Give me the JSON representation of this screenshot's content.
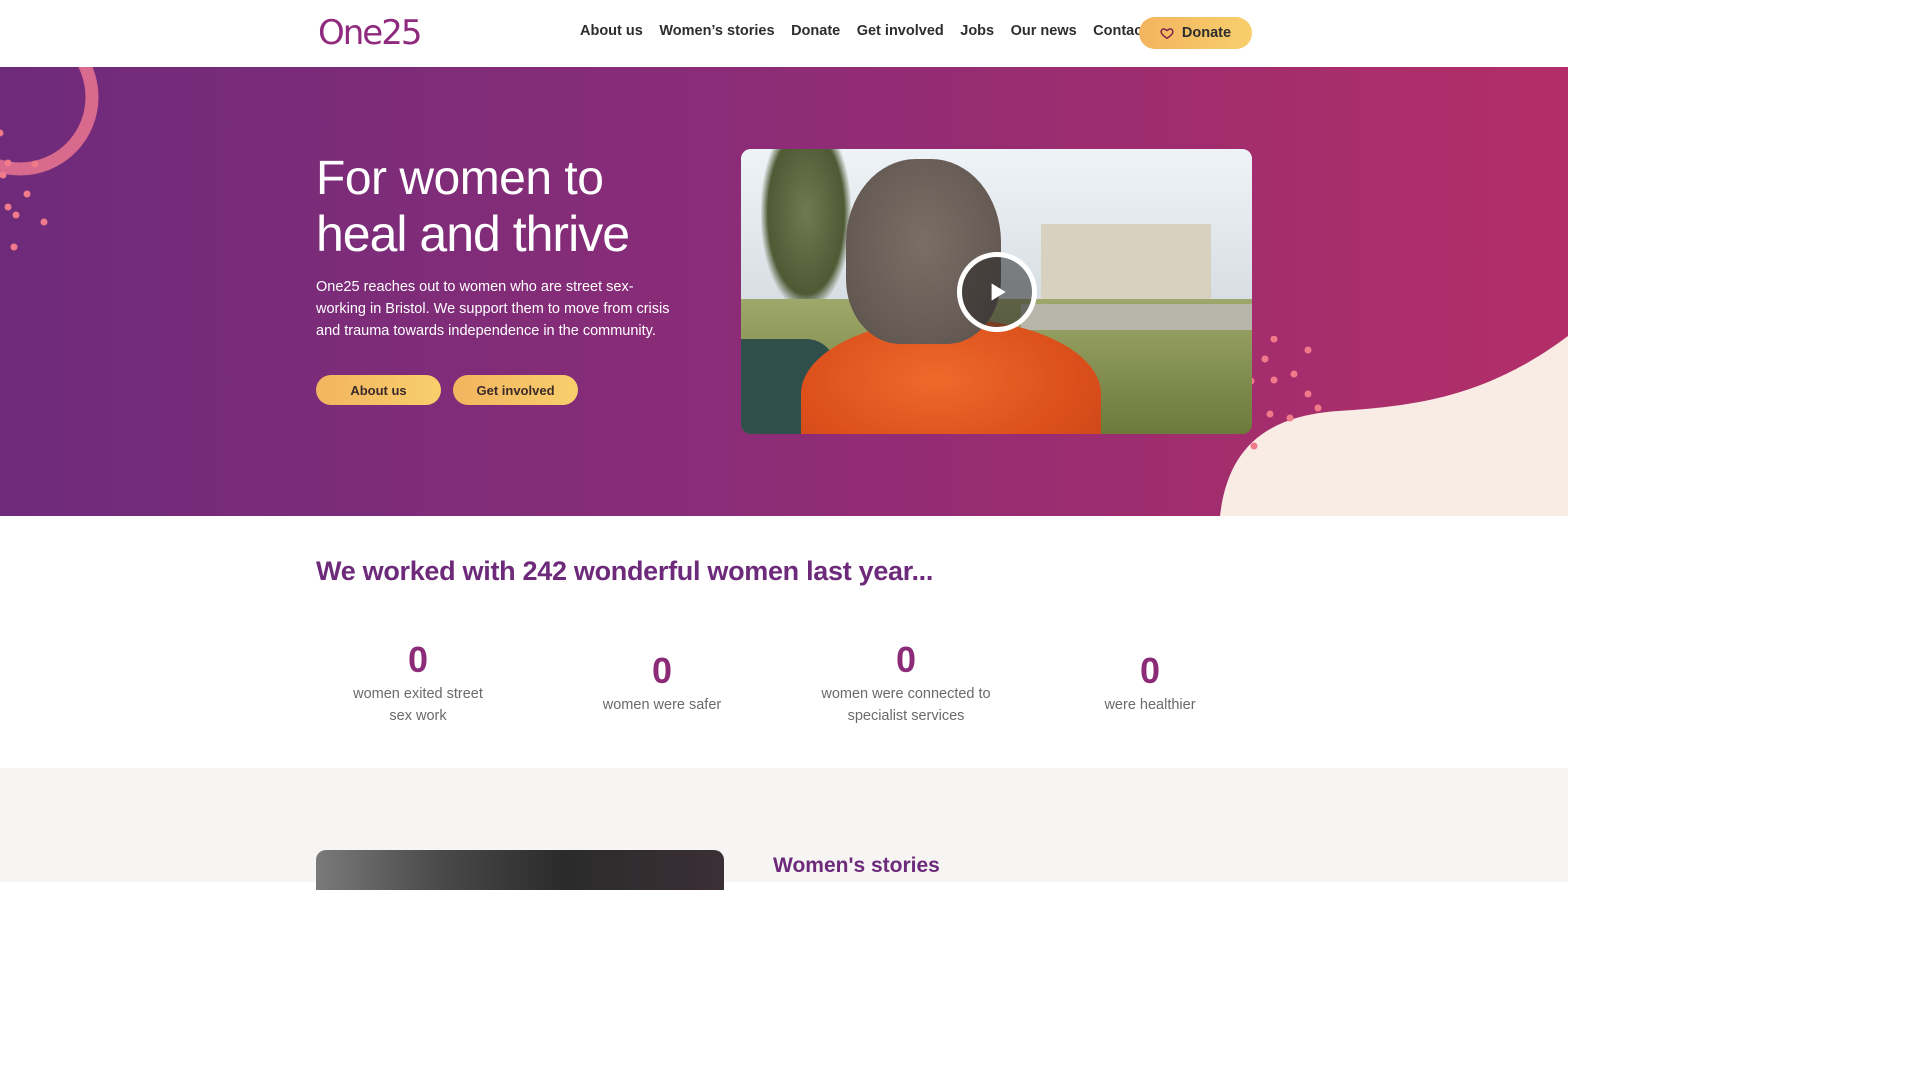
{
  "header": {
    "logo_text": "One25",
    "nav": [
      "About us",
      "Women’s stories",
      "Donate",
      "Get involved",
      "Jobs",
      "Our news",
      "Contact us"
    ],
    "donate_label": "Donate"
  },
  "hero": {
    "title_line1": "For women to",
    "title_line2": "heal and thrive",
    "text": "One25 reaches out to women who are street sex-working in Bristol. We support them to move from crisis and trauma towards independence in the community.",
    "buttons": [
      "About us",
      "Get involved"
    ]
  },
  "stats": {
    "heading": "We worked with 242 wonderful women last year...",
    "items": [
      {
        "value": "0",
        "label": "women exited street sex work"
      },
      {
        "value": "0",
        "label": "women were safer"
      },
      {
        "value": "0",
        "label": "women were connected to specialist services"
      },
      {
        "value": "0",
        "label": "were healthier"
      }
    ]
  },
  "stories": {
    "title": "Women's stories"
  },
  "colors": {
    "brand_purple": "#6d2a7a",
    "accent_yellow": "#f5c063",
    "hero_gradient_end": "#b32e68"
  }
}
